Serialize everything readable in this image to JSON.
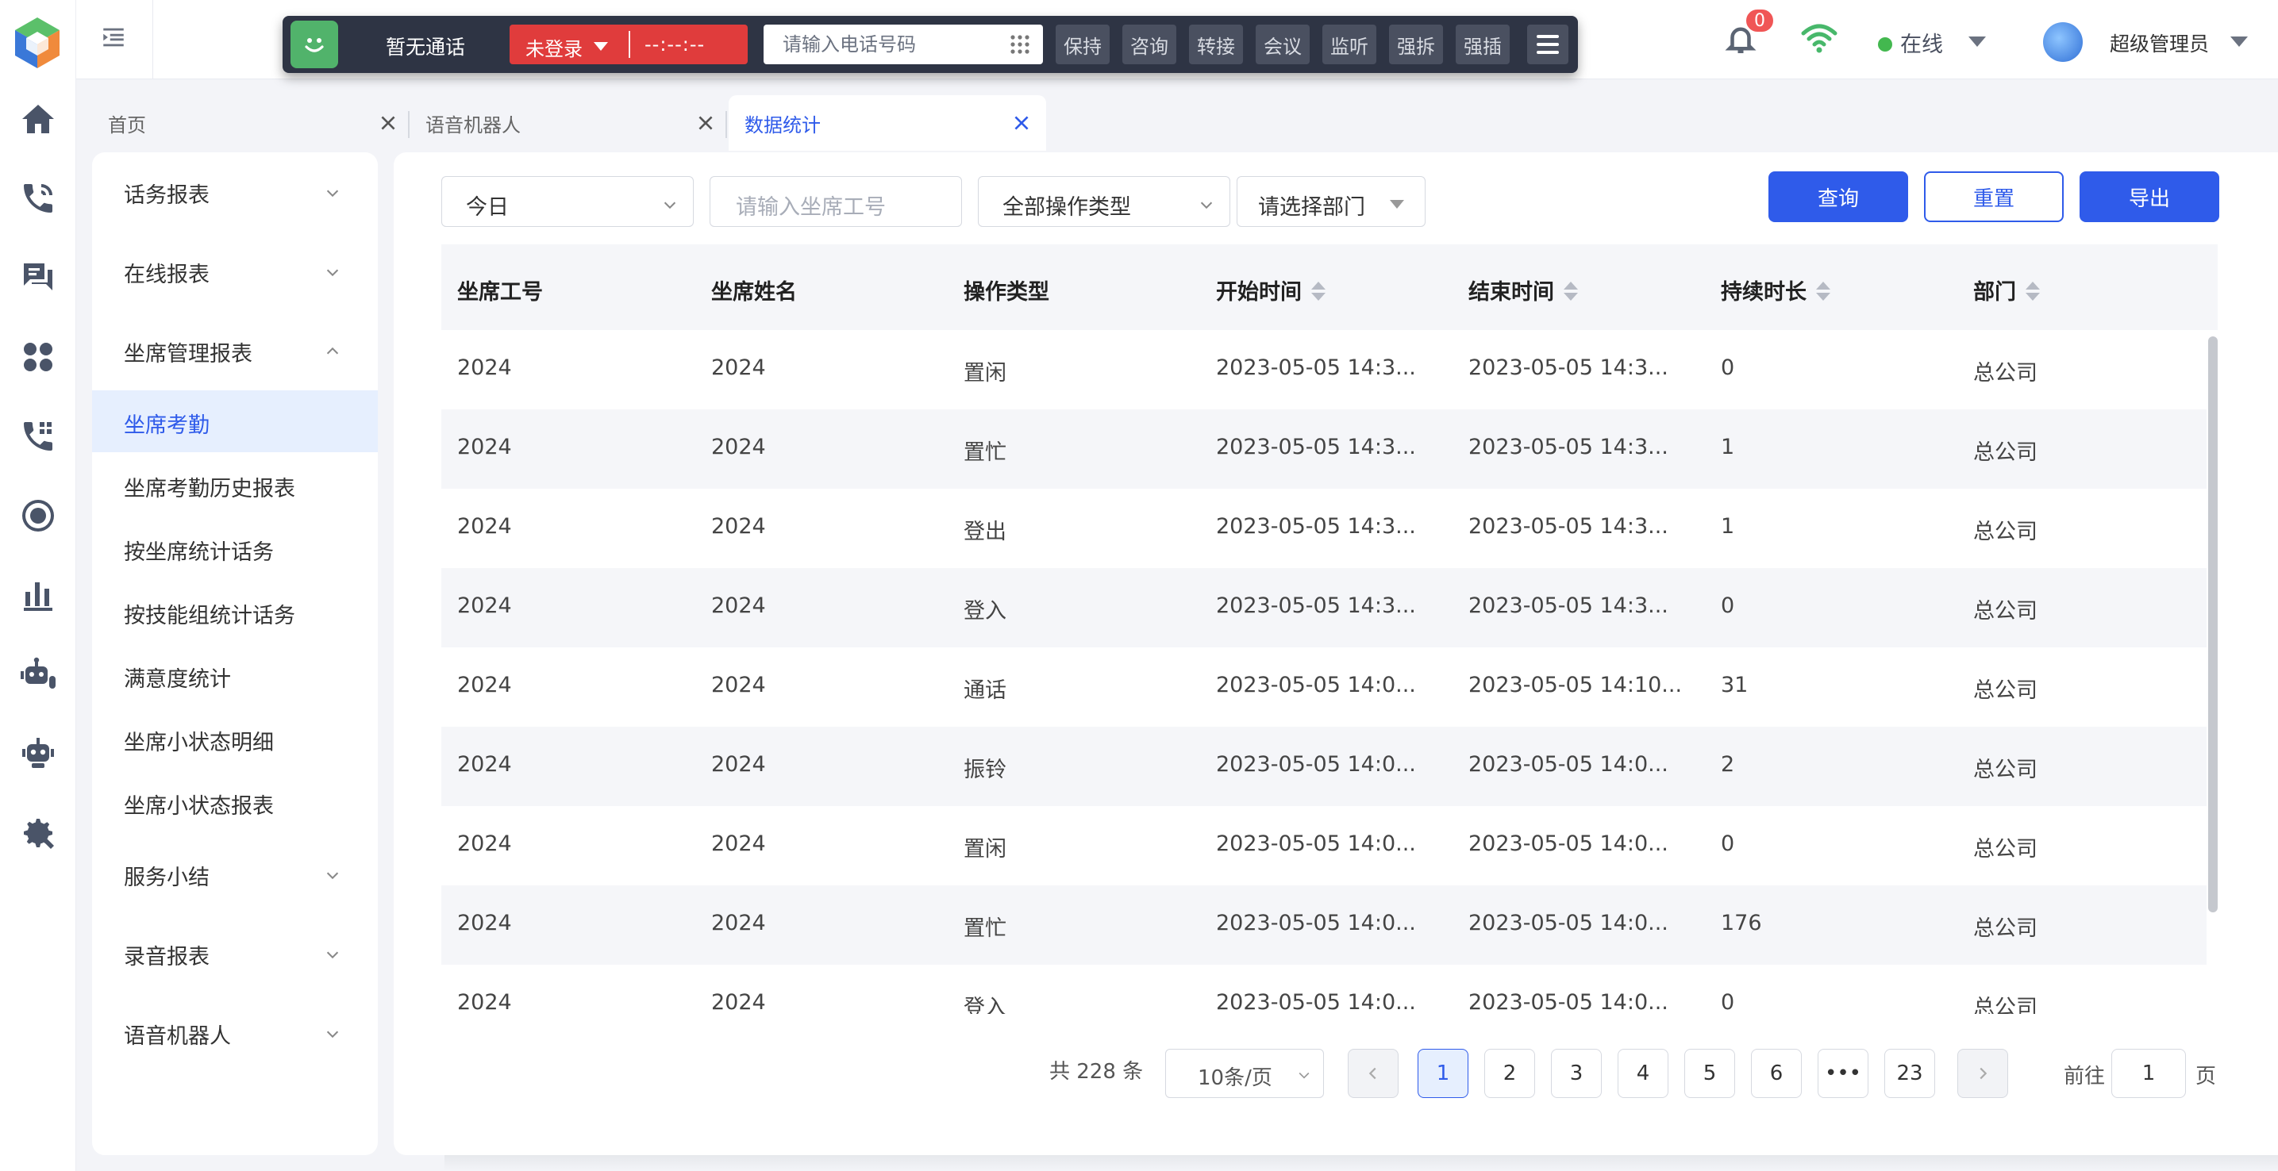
{
  "softphone": {
    "call_status": "暂无通话",
    "login_status": "未登录",
    "timer": "--:--:--",
    "phone_placeholder": "请输入电话号码",
    "buttons": [
      "保持",
      "咨询",
      "转接",
      "会议",
      "监听",
      "强拆",
      "强插"
    ]
  },
  "header": {
    "notification_count": "0",
    "presence": "在线",
    "user_name": "超级管理员"
  },
  "tabs": [
    {
      "label": "首页"
    },
    {
      "label": "语音机器人"
    },
    {
      "label": "数据统计"
    }
  ],
  "submenu": {
    "groups": [
      {
        "label": "话务报表"
      },
      {
        "label": "在线报表"
      },
      {
        "label": "坐席管理报表"
      }
    ],
    "sub_items": [
      {
        "label": "坐席考勤"
      },
      {
        "label": "坐席考勤历史报表"
      },
      {
        "label": "按坐席统计话务"
      },
      {
        "label": "按技能组统计话务"
      },
      {
        "label": "满意度统计"
      },
      {
        "label": "坐席小状态明细"
      },
      {
        "label": "坐席小状态报表"
      }
    ],
    "groups_after": [
      {
        "label": "服务小结"
      },
      {
        "label": "录音报表"
      },
      {
        "label": "语音机器人"
      }
    ]
  },
  "filters": {
    "date": "今日",
    "agent_id_placeholder": "请输入坐席工号",
    "op_type": "全部操作类型",
    "department": "请选择部门",
    "query": "查询",
    "reset": "重置",
    "export": "导出"
  },
  "table": {
    "columns": [
      "坐席工号",
      "坐席姓名",
      "操作类型",
      "开始时间",
      "结束时间",
      "持续时长",
      "部门"
    ],
    "rows": [
      [
        "2024",
        "2024",
        "置闲",
        "2023-05-05 14:3...",
        "2023-05-05 14:3...",
        "0",
        "总公司"
      ],
      [
        "2024",
        "2024",
        "置忙",
        "2023-05-05 14:3...",
        "2023-05-05 14:3...",
        "1",
        "总公司"
      ],
      [
        "2024",
        "2024",
        "登出",
        "2023-05-05 14:3...",
        "2023-05-05 14:3...",
        "1",
        "总公司"
      ],
      [
        "2024",
        "2024",
        "登入",
        "2023-05-05 14:3...",
        "2023-05-05 14:3...",
        "0",
        "总公司"
      ],
      [
        "2024",
        "2024",
        "通话",
        "2023-05-05 14:0...",
        "2023-05-05 14:10...",
        "31",
        "总公司"
      ],
      [
        "2024",
        "2024",
        "振铃",
        "2023-05-05 14:0...",
        "2023-05-05 14:0...",
        "2",
        "总公司"
      ],
      [
        "2024",
        "2024",
        "置闲",
        "2023-05-05 14:0...",
        "2023-05-05 14:0...",
        "0",
        "总公司"
      ],
      [
        "2024",
        "2024",
        "置忙",
        "2023-05-05 14:0...",
        "2023-05-05 14:0...",
        "176",
        "总公司"
      ],
      [
        "2024",
        "2024",
        "登入",
        "2023-05-05 14:0...",
        "2023-05-05 14:0...",
        "0",
        "总公司"
      ]
    ]
  },
  "pagination": {
    "total": "共 228 条",
    "page_size": "10条/页",
    "pages": [
      "1",
      "2",
      "3",
      "4",
      "5",
      "6",
      "•••",
      "23"
    ],
    "current": "1",
    "goto_prefix": "前往",
    "goto_value": "1",
    "goto_suffix": "页"
  },
  "icons": {
    "rail": [
      "home-icon",
      "phone-call-icon",
      "chat-icon",
      "apps-icon",
      "phone-keypad-icon",
      "record-icon",
      "bar-chart-icon",
      "robot-icon",
      "robot-alt-icon",
      "settings-tools-icon"
    ]
  },
  "colors": {
    "primary": "#2f5bea",
    "danger": "#e03c3c",
    "online": "#43b84f",
    "softphone_bg": "#2e3444"
  }
}
